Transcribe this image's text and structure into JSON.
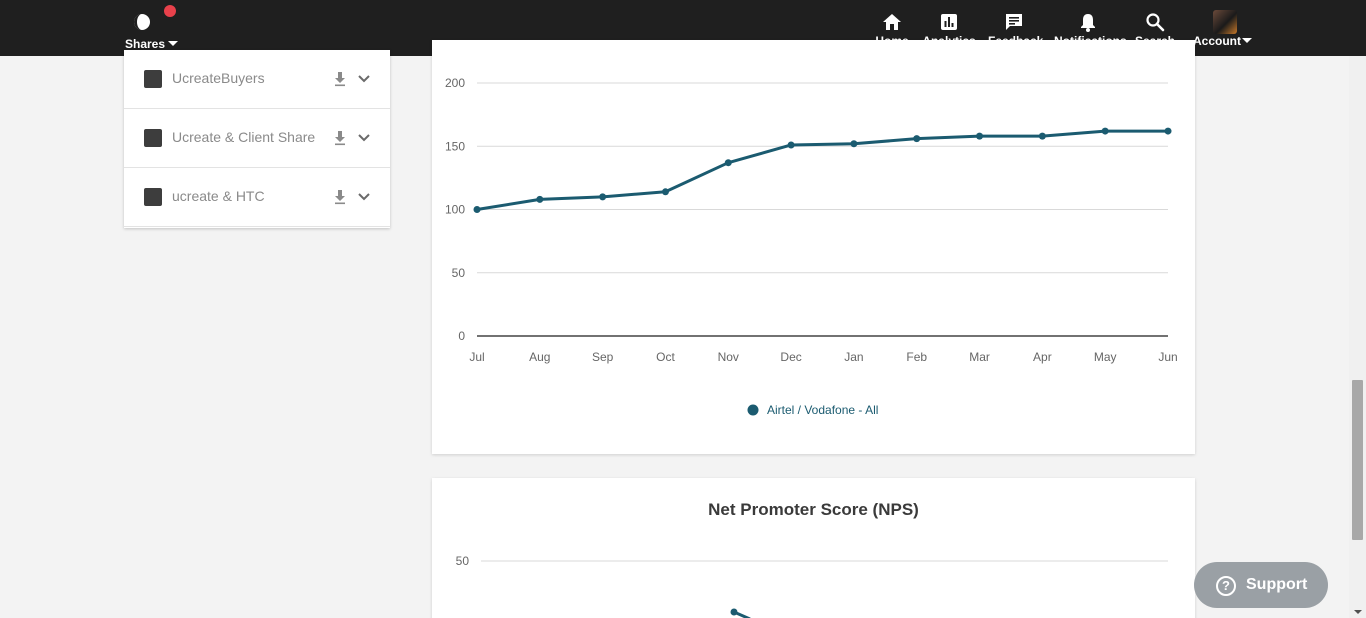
{
  "brand": {
    "label": "Shares"
  },
  "nav": [
    {
      "label": "Home",
      "icon": "home-icon"
    },
    {
      "label": "Analytics",
      "icon": "bar-chart-icon",
      "active": true
    },
    {
      "label": "Feedback",
      "icon": "chat-bubble-icon"
    },
    {
      "label": "Notifications",
      "icon": "bell-icon"
    },
    {
      "label": "Search",
      "icon": "search-icon"
    },
    {
      "label": "Account",
      "icon": "avatar"
    }
  ],
  "shares": [
    {
      "name": "UcreateBuyers"
    },
    {
      "name": "Ucreate & Client Share"
    },
    {
      "name": "ucreate & HTC"
    }
  ],
  "chart_data": [
    {
      "type": "line",
      "categories": [
        "Jul",
        "Aug",
        "Sep",
        "Oct",
        "Nov",
        "Dec",
        "Jan",
        "Feb",
        "Mar",
        "Apr",
        "May",
        "Jun"
      ],
      "series": [
        {
          "name": "Airtel / Vodafone - All",
          "values": [
            100,
            108,
            110,
            114,
            137,
            151,
            152,
            156,
            158,
            158,
            162,
            162
          ]
        }
      ],
      "yticks": [
        0,
        50,
        100,
        150,
        200
      ],
      "ylim": [
        0,
        200
      ],
      "grid": true,
      "legend": "bottom",
      "color": "#1b5b70"
    },
    {
      "type": "line",
      "title": "Net Promoter Score (NPS)",
      "yticks_visible": [
        50
      ],
      "color": "#1b5b70"
    }
  ],
  "support": {
    "label": "Support",
    "icon": "question-circle-icon"
  },
  "colors": {
    "topbar": "#1f1f1f",
    "accent": "#1b5b70",
    "notification_dot": "#e8414b",
    "support_button": "#9aa0a5"
  }
}
